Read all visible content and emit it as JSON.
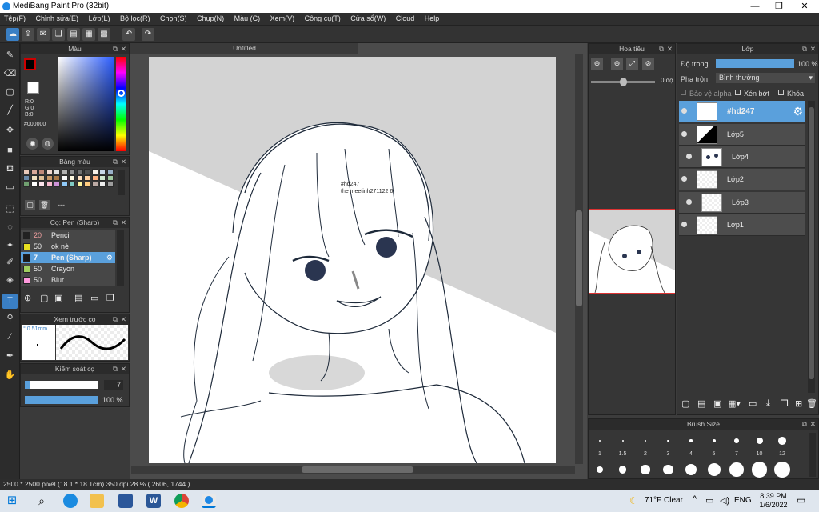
{
  "window": {
    "title": "MediBang Paint Pro (32bit)",
    "minimize": "—",
    "maximize": "❐",
    "close": "✕"
  },
  "menu": [
    "Tệp(F)",
    "Chỉnh sửa(E)",
    "Lớp(L)",
    "Bộ lọc(R)",
    "Chọn(S)",
    "Chụp(N)",
    "Màu (C)",
    "Xem(V)",
    "Công cụ(T)",
    "Cửa sổ(W)",
    "Cloud",
    "Help"
  ],
  "color_panel": {
    "title": "Màu",
    "r": "R:0",
    "g": "G:0",
    "b": "B:0",
    "hex": "#000000",
    "primary": "#000000",
    "secondary": "#ffffff"
  },
  "palette_panel": {
    "title": "Bảng màu",
    "dash": "---"
  },
  "brush_panel": {
    "title": "Cọ: Pen (Sharp)",
    "brushes": [
      {
        "size": "20",
        "name": "Pencil",
        "color": "#222222"
      },
      {
        "size": "50",
        "name": "ok nè",
        "color": "#e8e020"
      },
      {
        "size": "7",
        "name": "Pen (Sharp)",
        "color": "#1a1a1a"
      },
      {
        "size": "50",
        "name": "Crayon",
        "color": "#a0d060"
      },
      {
        "size": "50",
        "name": "Blur",
        "color": "#ff99dd"
      }
    ]
  },
  "brush_preview": {
    "title": "Xem trước cọ",
    "size_label": "° 0.51mm"
  },
  "brush_control": {
    "title": "Kiểm soát cọ",
    "size_value": "7",
    "opacity_value": "100 %",
    "size_fraction": 0.07,
    "opacity_fraction": 1.0
  },
  "document": {
    "tab": "Untitled",
    "text_line1": "#hd247",
    "text_line2": "the meetinh271122 6"
  },
  "navigator": {
    "title": "Hoa tiêu",
    "angle": "0 độ"
  },
  "layers_panel": {
    "title": "Lớp",
    "opacity_label": "Độ trong",
    "opacity_value": "100 %",
    "blend_label": "Pha trộn",
    "blend_value": "Bình thường",
    "protect_alpha": "Bảo vệ alpha",
    "clip": "Xén bớt",
    "lock": "Khóa",
    "layers": [
      {
        "name": "#hd247",
        "selected": true,
        "indent": false
      },
      {
        "name": "Lớp5",
        "selected": false,
        "indent": false
      },
      {
        "name": "Lớp4",
        "selected": false,
        "indent": true
      },
      {
        "name": "Lớp2",
        "selected": false,
        "indent": false
      },
      {
        "name": "Lớp3",
        "selected": false,
        "indent": true
      },
      {
        "name": "Lớp1",
        "selected": false,
        "indent": false
      }
    ]
  },
  "brush_size_panel": {
    "title": "Brush Size",
    "labels": [
      "1",
      "1.5",
      "2",
      "3",
      "4",
      "5",
      "7",
      "10",
      "12"
    ]
  },
  "status": {
    "text": "2500 * 2500 pixel   (18.1 * 18.1cm)   350 dpi   28 %   ( 2606, 1744 )"
  },
  "taskbar": {
    "weather": "71°F  Clear",
    "lang": "ENG",
    "time": "8:39 PM",
    "date": "1/6/2022",
    "chevron": "^"
  }
}
